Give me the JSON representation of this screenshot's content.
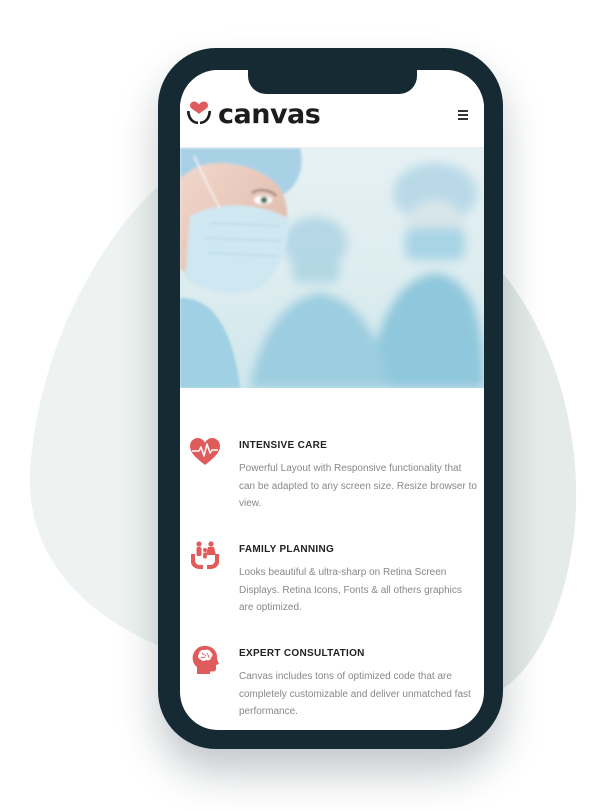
{
  "brand": {
    "name": "canvas",
    "accent_color": "#e05b5b",
    "phone_color": "#162a34",
    "blob_color": "#eaf0ef"
  },
  "header": {
    "logo_icon": "heart-hands-icon",
    "menu_icon": "hamburger-menu-icon"
  },
  "hero": {
    "image": "surgeons-in-masks-photo"
  },
  "features": [
    {
      "icon": "heart-pulse-icon",
      "title": "INTENSIVE CARE",
      "description": "Powerful Layout with Responsive functionality that can be adapted to any screen size. Resize browser to view."
    },
    {
      "icon": "family-hands-icon",
      "title": "FAMILY PLANNING",
      "description": "Looks beautiful & ultra-sharp on Retina Screen Displays. Retina Icons, Fonts & all others graphics are optimized."
    },
    {
      "icon": "head-brain-icon",
      "title": "EXPERT CONSULTATION",
      "description": "Canvas includes tons of optimized code that are completely customizable and deliver unmatched fast performance."
    }
  ]
}
